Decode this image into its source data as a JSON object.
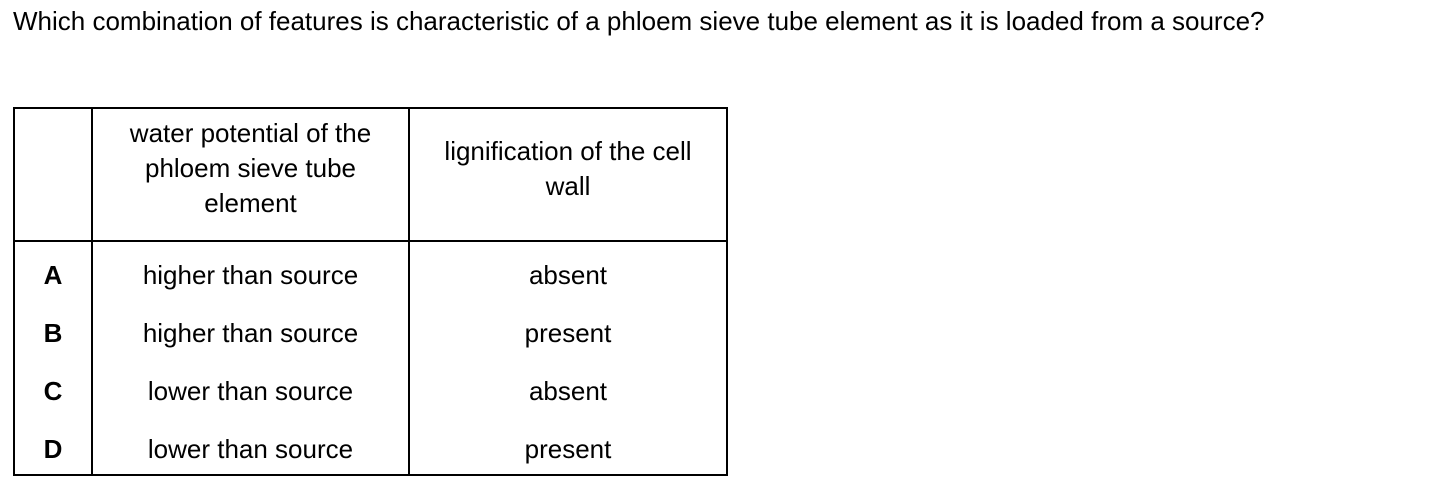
{
  "question": {
    "text": "Which combination of features is characteristic of a phloem sieve tube element as it is loaded from a source?"
  },
  "table": {
    "headers": [
      "",
      "water potential of the phloem sieve tube element",
      "lignification of the cell wall"
    ],
    "rows": [
      {
        "letter": "A",
        "water_potential": "higher than source",
        "lignification": "absent"
      },
      {
        "letter": "B",
        "water_potential": "higher than source",
        "lignification": "present"
      },
      {
        "letter": "C",
        "water_potential": "lower than source",
        "lignification": "absent"
      },
      {
        "letter": "D",
        "water_potential": "lower than source",
        "lignification": "present"
      }
    ]
  }
}
